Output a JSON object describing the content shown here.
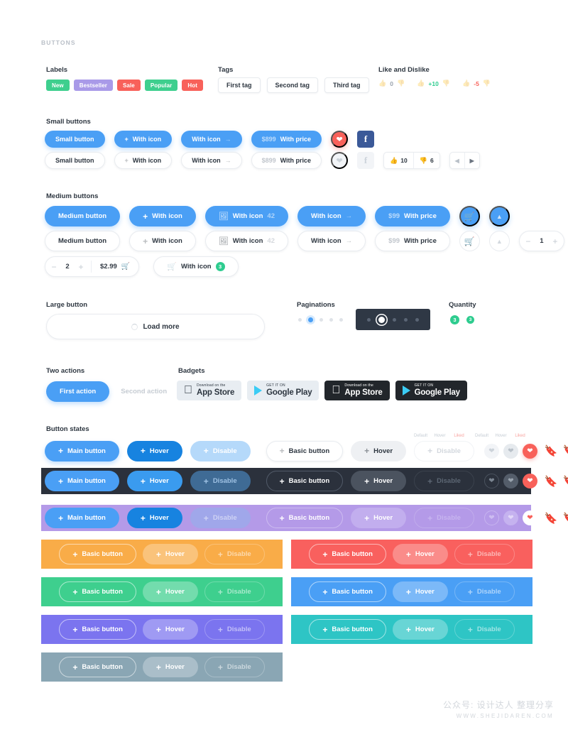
{
  "section_title": "BUTTONS",
  "groups": {
    "labels": "Labels",
    "tags": "Tags",
    "like_dislike": "Like and Dislike",
    "small_buttons": "Small buttons",
    "medium_buttons": "Medium buttons",
    "large_button": "Large button",
    "paginations": "Paginations",
    "quantity": "Quantity",
    "two_actions": "Two actions",
    "badgets": "Badgets",
    "button_states": "Button states"
  },
  "labels": [
    {
      "text": "New",
      "color": "#3ecf8e"
    },
    {
      "text": "Bestseller",
      "color": "#a99ae8"
    },
    {
      "text": "Sale",
      "color": "#f8615a"
    },
    {
      "text": "Popular",
      "color": "#3ecf8e"
    },
    {
      "text": "Hot",
      "color": "#f8615a"
    }
  ],
  "tags": [
    "First tag",
    "Second tag",
    "Third tag"
  ],
  "like_dislike": [
    {
      "value": "0",
      "color": "#9aa3ad"
    },
    {
      "value": "+10",
      "color": "#2ecc8f"
    },
    {
      "value": "-5",
      "color": "#f8615a"
    }
  ],
  "small_buttons": {
    "filled": {
      "plain": "Small button",
      "with_icon_plus": "With icon",
      "with_icon_arrow": "With icon",
      "price": "$899",
      "price_label": "With price"
    },
    "outline": {
      "plain": "Small button",
      "with_icon_plus": "With icon",
      "with_icon_arrow": "With icon",
      "price": "$899",
      "price_label": "With price"
    },
    "votes": {
      "up": "10",
      "down": "6"
    }
  },
  "medium_buttons": {
    "filled": {
      "plain": "Medium button",
      "with_icon_plus": "With icon",
      "with_icon_image": "With icon",
      "image_count": "42",
      "with_icon_arrow": "With icon",
      "price": "$99",
      "price_label": "With price"
    },
    "outline": {
      "plain": "Medium button",
      "with_icon_plus": "With icon",
      "with_icon_image": "With icon",
      "image_count": "42",
      "with_icon_arrow": "With icon",
      "price": "$99",
      "price_label": "With price"
    },
    "stepper_outline": {
      "value": "1"
    },
    "stepper_price": {
      "value": "2",
      "price": "$2.99"
    },
    "cart_badge_button": {
      "label": "With icon",
      "badge": "3"
    }
  },
  "large_button": {
    "label": "Load more"
  },
  "pagination": {
    "light": {
      "count": 5,
      "active": 1
    },
    "dark": {
      "count": 5,
      "active": 1
    }
  },
  "quantity": [
    {
      "value": "3",
      "size": "lg"
    },
    {
      "value": "3",
      "size": "sm"
    }
  ],
  "two_actions": {
    "first": "First action",
    "second": "Second action"
  },
  "badgets": [
    {
      "kind": "apple",
      "small": "Download on the",
      "big": "App Store",
      "theme": "light"
    },
    {
      "kind": "google",
      "small": "GET IT ON",
      "big": "Google Play",
      "theme": "light"
    },
    {
      "kind": "apple",
      "small": "Download on the",
      "big": "App Store",
      "theme": "dark"
    },
    {
      "kind": "google",
      "small": "GET IT ON",
      "big": "Google Play",
      "theme": "dark"
    }
  ],
  "button_states": {
    "state_labels": [
      "Default",
      "Hover",
      "Liked"
    ],
    "bookmark_labels": [
      "Default",
      "Hover",
      "Liked"
    ],
    "primary": {
      "main": "Main button",
      "hover": "Hover",
      "disable": "Disable"
    },
    "basic": {
      "main": "Basic button",
      "hover": "Hover",
      "disable": "Disable"
    }
  },
  "color_bands": [
    {
      "name": "orange",
      "bg": "#f9ac48",
      "main": "Basic button",
      "hover": "Hover",
      "disable": "Disable"
    },
    {
      "name": "red",
      "bg": "#f9605e",
      "main": "Basic button",
      "hover": "Hover",
      "disable": "Disable"
    },
    {
      "name": "green",
      "bg": "#3ecf8e",
      "main": "Basic button",
      "hover": "Hover",
      "disable": "Disable"
    },
    {
      "name": "blue",
      "bg": "#4a9ff5",
      "main": "Basic button",
      "hover": "Hover",
      "disable": "Disable"
    },
    {
      "name": "indigo",
      "bg": "#7b74ef",
      "main": "Basic button",
      "hover": "Hover",
      "disable": "Disable"
    },
    {
      "name": "teal",
      "bg": "#2ec5c5",
      "main": "Basic button",
      "hover": "Hover",
      "disable": "Disable"
    },
    {
      "name": "slate",
      "bg": "#8aa6b4",
      "main": "Basic button",
      "hover": "Hover",
      "disable": "Disable"
    }
  ],
  "dark_band_bg": "#2b313c",
  "purple_band_bg": "#b49ae8",
  "accent": "#4a9ff5",
  "watermark": {
    "line1": "公众号: 设计达人 整理分享",
    "line2": "WWW.SHEJIDAREN.COM"
  }
}
